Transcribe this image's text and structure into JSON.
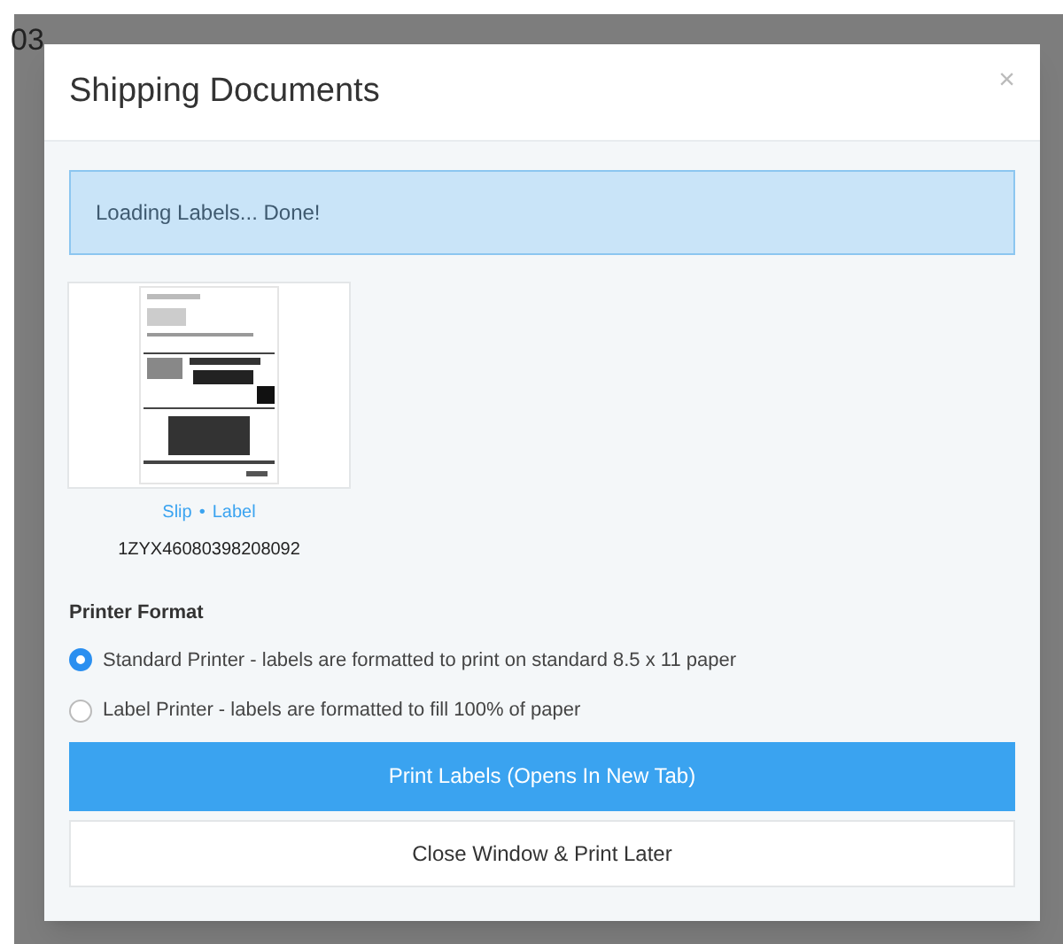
{
  "background": {
    "order_number_fragment": "03"
  },
  "modal": {
    "title": "Shipping Documents",
    "close": "×",
    "alert": "Loading Labels... Done!",
    "documents": [
      {
        "links": [
          "Slip",
          "Label"
        ],
        "separator": "•",
        "tracking": "1ZYX46080398208092"
      }
    ],
    "printer_format": {
      "label": "Printer Format",
      "options": [
        {
          "label": "Standard Printer - labels are formatted to print on standard 8.5 x 11 paper",
          "selected": true
        },
        {
          "label": "Label Printer - labels are formatted to fill 100% of paper",
          "selected": false
        }
      ]
    },
    "buttons": [
      {
        "label": "Print Labels (Opens In New Tab)",
        "kind": "primary"
      },
      {
        "label": "Close Window & Print Later",
        "kind": "secondary"
      }
    ]
  }
}
